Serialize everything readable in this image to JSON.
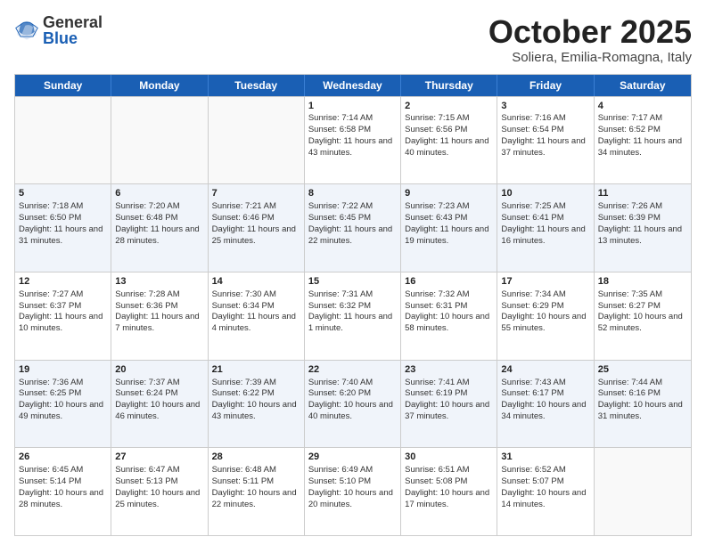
{
  "header": {
    "logo_general": "General",
    "logo_blue": "Blue",
    "month_title": "October 2025",
    "location": "Soliera, Emilia-Romagna, Italy"
  },
  "days_of_week": [
    "Sunday",
    "Monday",
    "Tuesday",
    "Wednesday",
    "Thursday",
    "Friday",
    "Saturday"
  ],
  "weeks": [
    [
      {
        "day": "",
        "info": ""
      },
      {
        "day": "",
        "info": ""
      },
      {
        "day": "",
        "info": ""
      },
      {
        "day": "1",
        "info": "Sunrise: 7:14 AM\nSunset: 6:58 PM\nDaylight: 11 hours and 43 minutes."
      },
      {
        "day": "2",
        "info": "Sunrise: 7:15 AM\nSunset: 6:56 PM\nDaylight: 11 hours and 40 minutes."
      },
      {
        "day": "3",
        "info": "Sunrise: 7:16 AM\nSunset: 6:54 PM\nDaylight: 11 hours and 37 minutes."
      },
      {
        "day": "4",
        "info": "Sunrise: 7:17 AM\nSunset: 6:52 PM\nDaylight: 11 hours and 34 minutes."
      }
    ],
    [
      {
        "day": "5",
        "info": "Sunrise: 7:18 AM\nSunset: 6:50 PM\nDaylight: 11 hours and 31 minutes."
      },
      {
        "day": "6",
        "info": "Sunrise: 7:20 AM\nSunset: 6:48 PM\nDaylight: 11 hours and 28 minutes."
      },
      {
        "day": "7",
        "info": "Sunrise: 7:21 AM\nSunset: 6:46 PM\nDaylight: 11 hours and 25 minutes."
      },
      {
        "day": "8",
        "info": "Sunrise: 7:22 AM\nSunset: 6:45 PM\nDaylight: 11 hours and 22 minutes."
      },
      {
        "day": "9",
        "info": "Sunrise: 7:23 AM\nSunset: 6:43 PM\nDaylight: 11 hours and 19 minutes."
      },
      {
        "day": "10",
        "info": "Sunrise: 7:25 AM\nSunset: 6:41 PM\nDaylight: 11 hours and 16 minutes."
      },
      {
        "day": "11",
        "info": "Sunrise: 7:26 AM\nSunset: 6:39 PM\nDaylight: 11 hours and 13 minutes."
      }
    ],
    [
      {
        "day": "12",
        "info": "Sunrise: 7:27 AM\nSunset: 6:37 PM\nDaylight: 11 hours and 10 minutes."
      },
      {
        "day": "13",
        "info": "Sunrise: 7:28 AM\nSunset: 6:36 PM\nDaylight: 11 hours and 7 minutes."
      },
      {
        "day": "14",
        "info": "Sunrise: 7:30 AM\nSunset: 6:34 PM\nDaylight: 11 hours and 4 minutes."
      },
      {
        "day": "15",
        "info": "Sunrise: 7:31 AM\nSunset: 6:32 PM\nDaylight: 11 hours and 1 minute."
      },
      {
        "day": "16",
        "info": "Sunrise: 7:32 AM\nSunset: 6:31 PM\nDaylight: 10 hours and 58 minutes."
      },
      {
        "day": "17",
        "info": "Sunrise: 7:34 AM\nSunset: 6:29 PM\nDaylight: 10 hours and 55 minutes."
      },
      {
        "day": "18",
        "info": "Sunrise: 7:35 AM\nSunset: 6:27 PM\nDaylight: 10 hours and 52 minutes."
      }
    ],
    [
      {
        "day": "19",
        "info": "Sunrise: 7:36 AM\nSunset: 6:25 PM\nDaylight: 10 hours and 49 minutes."
      },
      {
        "day": "20",
        "info": "Sunrise: 7:37 AM\nSunset: 6:24 PM\nDaylight: 10 hours and 46 minutes."
      },
      {
        "day": "21",
        "info": "Sunrise: 7:39 AM\nSunset: 6:22 PM\nDaylight: 10 hours and 43 minutes."
      },
      {
        "day": "22",
        "info": "Sunrise: 7:40 AM\nSunset: 6:20 PM\nDaylight: 10 hours and 40 minutes."
      },
      {
        "day": "23",
        "info": "Sunrise: 7:41 AM\nSunset: 6:19 PM\nDaylight: 10 hours and 37 minutes."
      },
      {
        "day": "24",
        "info": "Sunrise: 7:43 AM\nSunset: 6:17 PM\nDaylight: 10 hours and 34 minutes."
      },
      {
        "day": "25",
        "info": "Sunrise: 7:44 AM\nSunset: 6:16 PM\nDaylight: 10 hours and 31 minutes."
      }
    ],
    [
      {
        "day": "26",
        "info": "Sunrise: 6:45 AM\nSunset: 5:14 PM\nDaylight: 10 hours and 28 minutes."
      },
      {
        "day": "27",
        "info": "Sunrise: 6:47 AM\nSunset: 5:13 PM\nDaylight: 10 hours and 25 minutes."
      },
      {
        "day": "28",
        "info": "Sunrise: 6:48 AM\nSunset: 5:11 PM\nDaylight: 10 hours and 22 minutes."
      },
      {
        "day": "29",
        "info": "Sunrise: 6:49 AM\nSunset: 5:10 PM\nDaylight: 10 hours and 20 minutes."
      },
      {
        "day": "30",
        "info": "Sunrise: 6:51 AM\nSunset: 5:08 PM\nDaylight: 10 hours and 17 minutes."
      },
      {
        "day": "31",
        "info": "Sunrise: 6:52 AM\nSunset: 5:07 PM\nDaylight: 10 hours and 14 minutes."
      },
      {
        "day": "",
        "info": ""
      }
    ]
  ]
}
